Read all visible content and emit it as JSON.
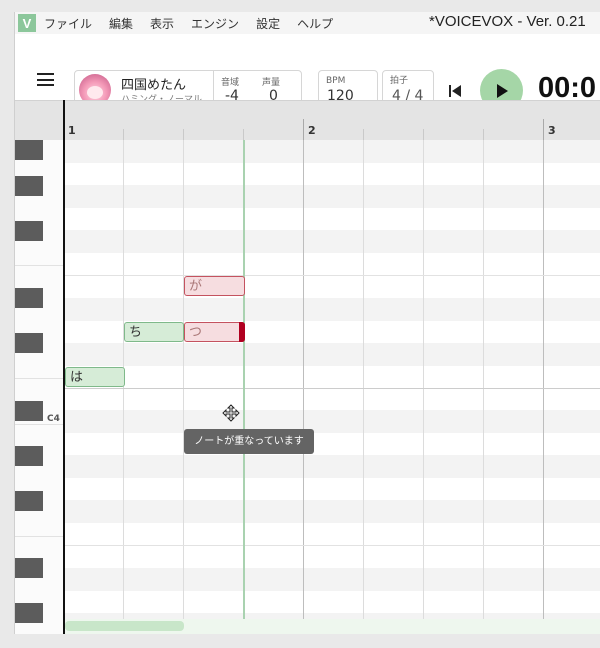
{
  "menubar": {
    "logo": "V",
    "items": [
      "ファイル",
      "編集",
      "表示",
      "エンジン",
      "設定",
      "ヘルプ"
    ],
    "title": "*VOICEVOX - Ver. 0.21"
  },
  "toolbar": {
    "singer": {
      "name": "四国めたん",
      "style": "ハミング・ノーマル"
    },
    "key_shift": {
      "label": "音域",
      "value": "-4"
    },
    "volume": {
      "label": "声量",
      "value": "0"
    },
    "bpm": {
      "label": "BPM",
      "value": "120"
    },
    "time_signature": {
      "label": "拍子",
      "value": "4 / 4"
    },
    "timer": "00:0"
  },
  "editor": {
    "bars": [
      "1",
      "2",
      "3"
    ],
    "pitch_label": "C4",
    "notes": [
      {
        "lyric": "は",
        "state": "normal"
      },
      {
        "lyric": "ち",
        "state": "normal"
      },
      {
        "lyric": "つ",
        "state": "overlapping"
      },
      {
        "lyric": "が",
        "state": "overlapping"
      }
    ],
    "tooltip": "ノートが重なっています"
  },
  "colors": {
    "accent": "#a5d6a7",
    "note_normal": "#d6ecd7",
    "note_error": "#c4525f"
  }
}
